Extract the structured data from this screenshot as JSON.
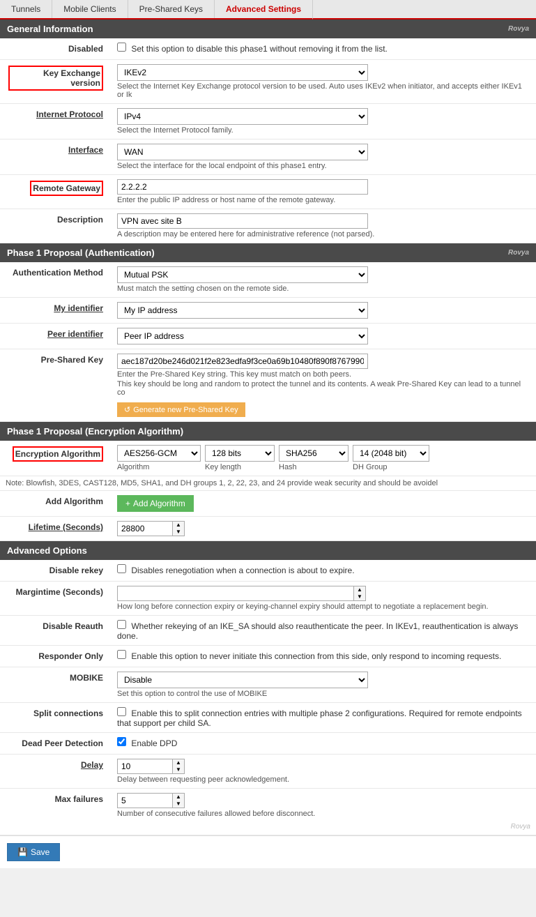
{
  "tabs": [
    {
      "label": "Tunnels",
      "active": false
    },
    {
      "label": "Mobile Clients",
      "active": false
    },
    {
      "label": "Pre-Shared Keys",
      "active": false
    },
    {
      "label": "Advanced Settings",
      "active": true
    }
  ],
  "general": {
    "header": "General Information",
    "logo": "Rovya",
    "disabled_label": "Disabled",
    "disabled_help": "Set this option to disable this phase1 without removing it from the list.",
    "key_exchange_label": "Key Exchange version",
    "key_exchange_value": "IKEv2",
    "key_exchange_help": "Select the Internet Key Exchange protocol version to be used. Auto uses IKEv2 when initiator, and accepts either IKEv1 or Ik",
    "internet_protocol_label": "Internet Protocol",
    "internet_protocol_value": "IPv4",
    "internet_protocol_help": "Select the Internet Protocol family.",
    "interface_label": "Interface",
    "interface_value": "WAN",
    "interface_help": "Select the interface for the local endpoint of this phase1 entry.",
    "remote_gateway_label": "Remote Gateway",
    "remote_gateway_value": "2.2.2.2",
    "remote_gateway_help": "Enter the public IP address or host name of the remote gateway.",
    "description_label": "Description",
    "description_value": "VPN avec site B",
    "description_help": "A description may be entered here for administrative reference (not parsed)."
  },
  "phase1_auth": {
    "header": "Phase 1 Proposal (Authentication)",
    "logo": "Rovya",
    "auth_method_label": "Authentication Method",
    "auth_method_value": "Mutual PSK",
    "auth_method_help": "Must match the setting chosen on the remote side.",
    "my_identifier_label": "My identifier",
    "my_identifier_value": "My IP address",
    "peer_identifier_label": "Peer identifier",
    "peer_identifier_value": "Peer IP address",
    "psk_label": "Pre-Shared Key",
    "psk_value": "aec187d20be246d021f2e823edfa9f3ce0a69b10480f890f87679900",
    "psk_help1": "Enter the Pre-Shared Key string. This key must match on both peers.",
    "psk_help2": "This key should be long and random to protect the tunnel and its contents. A weak Pre-Shared Key can lead to a tunnel co",
    "generate_label": "Generate new Pre-Shared Key"
  },
  "phase1_enc": {
    "header": "Phase 1 Proposal (Encryption Algorithm)",
    "enc_algorithm_label": "Encryption Algorithm",
    "algorithm_value": "AES256-GCM",
    "algorithm_label": "Algorithm",
    "key_length_value": "128 bits",
    "key_length_label": "Key length",
    "hash_value": "SHA256",
    "hash_label": "Hash",
    "dh_group_value": "14 (2048 bit)",
    "dh_group_label": "DH Group",
    "note": "Note: Blowfish, 3DES, CAST128, MD5, SHA1, and DH groups 1, 2, 22, 23, and 24 provide weak security and should be avoidel",
    "add_algorithm_label": "Add Algorithm",
    "lifetime_label": "Lifetime (Seconds)",
    "lifetime_value": "28800"
  },
  "advanced": {
    "header": "Advanced Options",
    "disable_rekey_label": "Disable rekey",
    "disable_rekey_help": "Disables renegotiation when a connection is about to expire.",
    "margintime_label": "Margintime (Seconds)",
    "margintime_value": "",
    "margintime_help": "How long before connection expiry or keying-channel expiry should attempt to negotiate a replacement begin.",
    "disable_reauth_label": "Disable Reauth",
    "disable_reauth_help": "Whether rekeying of an IKE_SA should also reauthenticate the peer. In IKEv1, reauthentication is always done.",
    "responder_only_label": "Responder Only",
    "responder_only_help": "Enable this option to never initiate this connection from this side, only respond to incoming requests.",
    "mobike_label": "MOBIKE",
    "mobike_value": "Disable",
    "mobike_help": "Set this option to control the use of MOBIKE",
    "split_connections_label": "Split connections",
    "split_connections_help": "Enable this to split connection entries with multiple phase 2 configurations. Required for remote endpoints that support per child SA.",
    "dead_peer_label": "Dead Peer Detection",
    "dead_peer_value": "Enable DPD",
    "dead_peer_checked": true,
    "delay_label": "Delay",
    "delay_value": "10",
    "delay_help": "Delay between requesting peer acknowledgement.",
    "max_failures_label": "Max failures",
    "max_failures_value": "5",
    "max_failures_help": "Number of consecutive failures allowed before disconnect.",
    "logo": "Rovya"
  },
  "footer": {
    "save_label": "Save"
  }
}
